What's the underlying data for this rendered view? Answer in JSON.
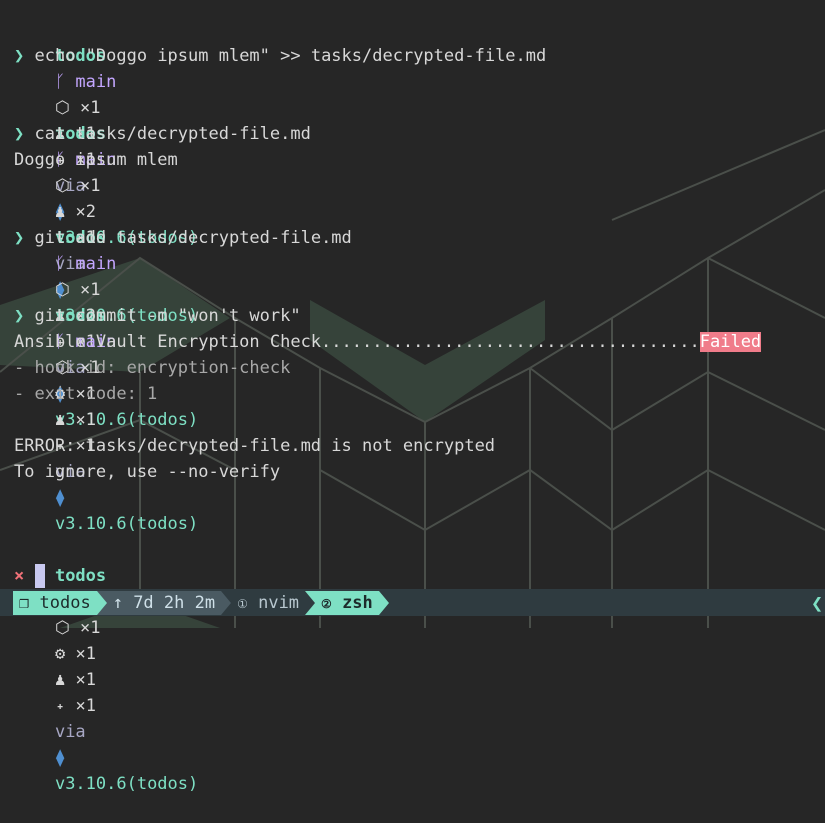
{
  "prompt": {
    "dir": "todos",
    "branch_icon": "git-branch-icon",
    "branch": "main",
    "via": "via",
    "python_icon": "python-icon",
    "python_version": "v3.10.6(todos)",
    "ok_symbol": "❯",
    "error_symbol": "×"
  },
  "blocks": [
    {
      "counts": {
        "staged": "×1",
        "stashed": "×1",
        "untracked": "×1"
      },
      "command": "echo \"Doggo ipsum mlem\" >> tasks/decrypted-file.md",
      "output": []
    },
    {
      "counts": {
        "staged": "×1",
        "stashed": "×2",
        "untracked": "×1"
      },
      "command": "cat tasks/decrypted-file.md",
      "output": [
        "Doggo ipsum mlem"
      ]
    },
    {
      "counts": {
        "staged": "×1",
        "stashed": "×2",
        "untracked": "×1"
      },
      "command": "git add tasks/decrypted-file.md",
      "output": []
    },
    {
      "counts": {
        "staged": "×1",
        "modified": "×1",
        "stashed": "×1",
        "untracked": "×1"
      },
      "command": "git commit -m \"won't work\"",
      "hook_name": "Ansible Vault Encryption Check.....................................",
      "hook_status": "Failed",
      "output": [
        "- hook id: encryption-check",
        "- exit code: 1",
        "",
        "ERROR: tasks/decrypted-file.md is not encrypted",
        "To ignore, use --no-verify"
      ]
    },
    {
      "counts": {
        "staged": "×1",
        "modified": "×1",
        "stashed": "×1",
        "untracked": "×1"
      }
    }
  ],
  "statusbar": {
    "session_icon": "❐",
    "session": "todos",
    "uptime_icon": "↑",
    "uptime": "7d 2h 2m",
    "windows": [
      {
        "index": "①",
        "name": "nvim"
      },
      {
        "index": "②",
        "name": "zsh"
      }
    ]
  },
  "colors": {
    "background": "#262626",
    "accent": "#7ee0c4",
    "branch": "#c3a6ff",
    "failed": "#f07c8a",
    "error": "#f07178"
  }
}
